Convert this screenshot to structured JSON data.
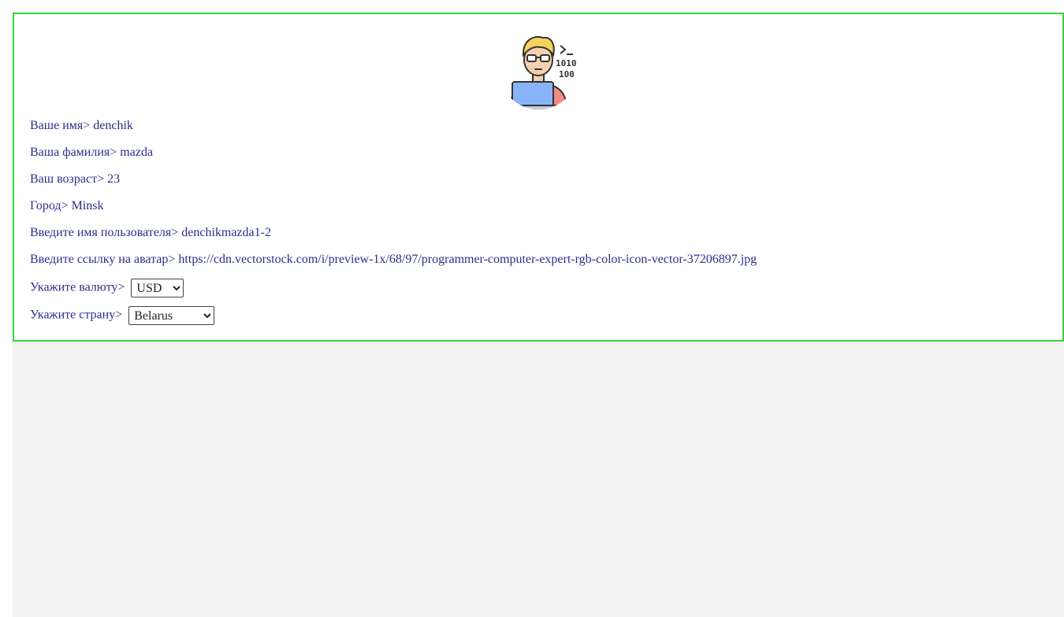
{
  "profile": {
    "avatar_icon": "programmer-computer-icon",
    "separator": ">",
    "fields": {
      "name": {
        "label": "Ваше имя",
        "value": "denchik"
      },
      "surname": {
        "label": "Ваша фамилия",
        "value": "mazda"
      },
      "age": {
        "label": "Ваш возраст",
        "value": "23"
      },
      "city": {
        "label": "Город",
        "value": "Minsk"
      },
      "username": {
        "label": "Введите имя пользователя",
        "value": "denchikmazda1-2"
      },
      "avatar_url": {
        "label": "Введите ссылку на аватар",
        "value": "https://cdn.vectorstock.com/i/preview-1x/68/97/programmer-computer-expert-rgb-color-icon-vector-37206897.jpg"
      },
      "currency": {
        "label": "Укажите валюту",
        "selected": "USD"
      },
      "country": {
        "label": "Укажите страну",
        "selected": "Belarus"
      }
    },
    "colors": {
      "border": "#3ad23a",
      "text": "#2d2d8c",
      "page_background": "#f2f2f2"
    }
  }
}
